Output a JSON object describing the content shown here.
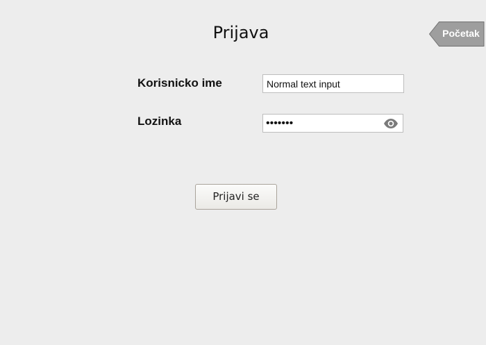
{
  "header": {
    "title": "Prijava",
    "back_button_label": "Početak"
  },
  "form": {
    "username": {
      "label": "Korisnicko ime",
      "value": "Normal text input"
    },
    "password": {
      "label": "Lozinka",
      "value": "•••••••",
      "toggle_icon": "eye-icon"
    },
    "submit_label": "Prijavi se"
  },
  "colors": {
    "background": "#ededed",
    "back_button_fill": "#9e9e9e",
    "back_button_text": "#ffffff",
    "input_border": "#bdbdbd",
    "button_border": "#a9a39a"
  }
}
